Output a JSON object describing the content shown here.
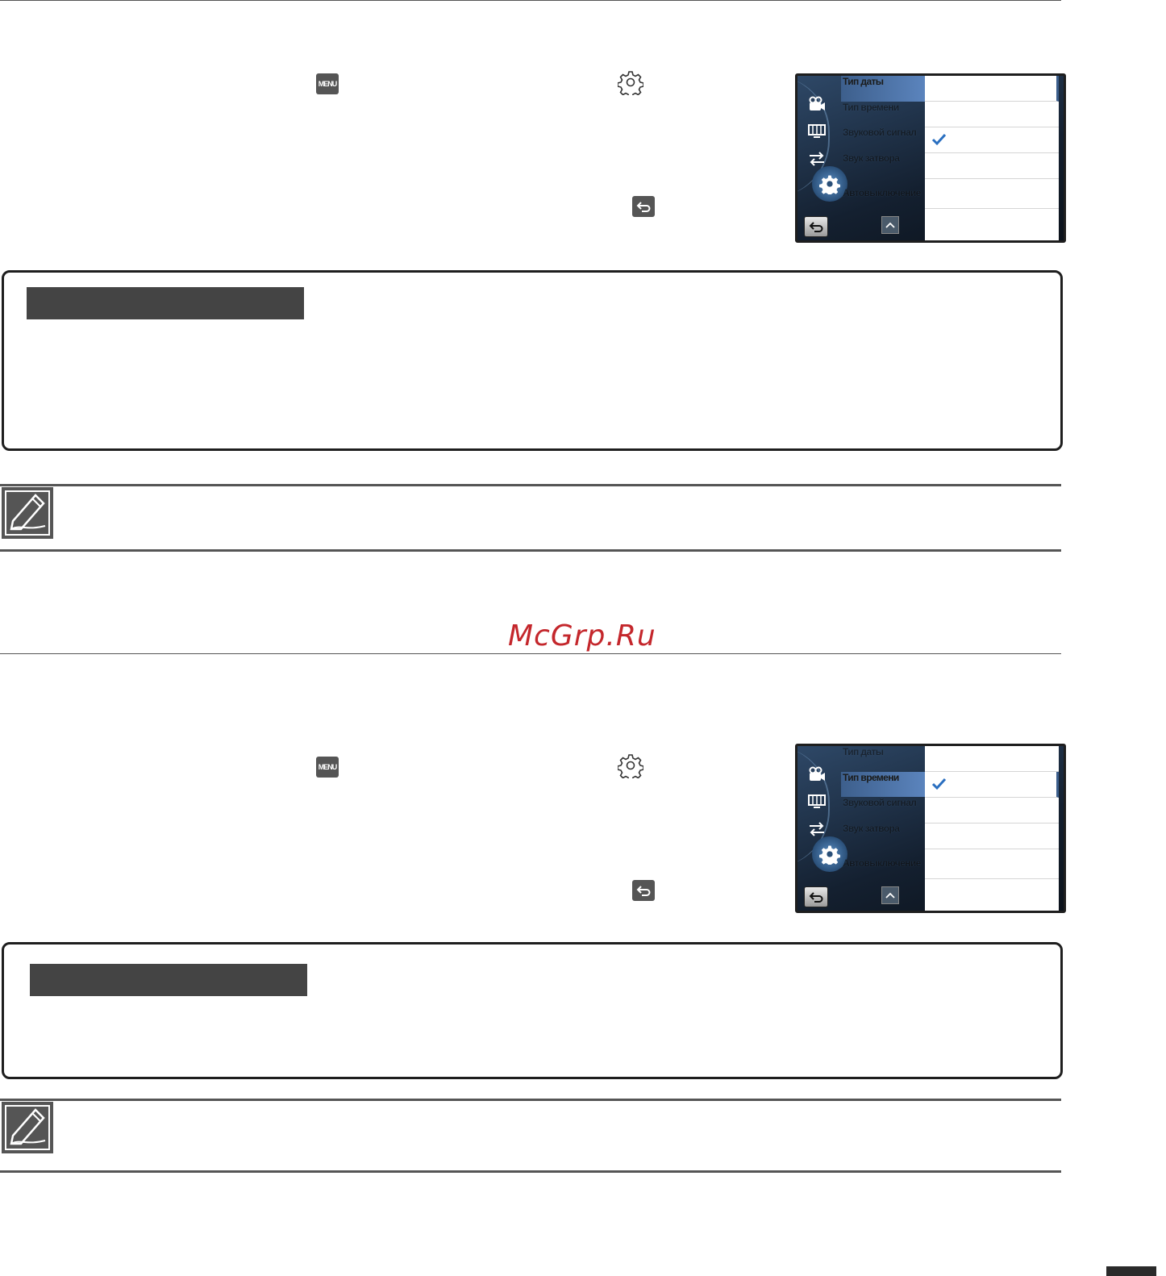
{
  "watermark": "McGrp.Ru",
  "sections": [
    {
      "keys": {
        "menu_label": "MENU",
        "menu_icon": "menu-key-icon",
        "settings_icon": "gear-icon",
        "back_icon": "back-arrow-icon"
      },
      "screen": {
        "items": [
          "Тип даты",
          "Тип времени",
          "Звуковой сигнал",
          "Звук затвора",
          "Автовыключение"
        ],
        "selected_index": 0,
        "checked_option": 2,
        "side_icons": [
          "camera-icon",
          "display-icon",
          "connection-icon",
          "settings-gear-icon"
        ]
      }
    },
    {
      "keys": {
        "menu_label": "MENU",
        "menu_icon": "menu-key-icon",
        "settings_icon": "gear-icon",
        "back_icon": "back-arrow-icon"
      },
      "screen": {
        "items": [
          "Тип даты",
          "Тип времени",
          "Звуковой сигнал",
          "Звук затвора",
          "Автовыключение"
        ],
        "selected_index": 1,
        "checked_option": 1,
        "side_icons": [
          "camera-icon",
          "display-icon",
          "connection-icon",
          "settings-gear-icon"
        ]
      }
    }
  ],
  "colors": {
    "accent": "#3d5f8c",
    "check": "#2a6fc0",
    "watermark": "#c4272c"
  }
}
